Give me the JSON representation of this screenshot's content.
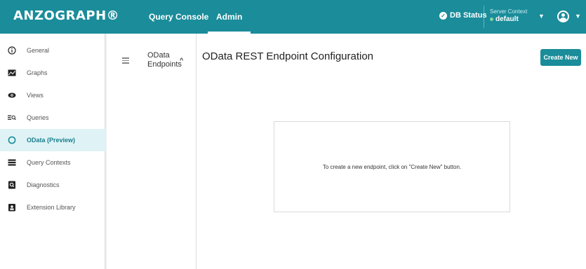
{
  "header": {
    "brand": "ANZOGRAPH®",
    "nav": [
      {
        "label": "Query Console"
      },
      {
        "label": "Admin"
      }
    ],
    "db_status": "DB Status",
    "server_context_label": "Server Context",
    "server_context_value": "default",
    "accent_color": "#1a8c9a"
  },
  "sidebar": {
    "items": [
      {
        "label": "General",
        "icon": "info-circle-icon"
      },
      {
        "label": "Graphs",
        "icon": "image-graph-icon"
      },
      {
        "label": "Views",
        "icon": "eye-icon"
      },
      {
        "label": "Queries",
        "icon": "queries-search-icon"
      },
      {
        "label": "OData (Preview)",
        "icon": "odata-circle-icon",
        "active": true
      },
      {
        "label": "Query Contexts",
        "icon": "list-icon"
      },
      {
        "label": "Diagnostics",
        "icon": "diagnostics-icon"
      },
      {
        "label": "Extension Library",
        "icon": "library-icon"
      }
    ]
  },
  "subnav": {
    "heading_line1": "OData",
    "heading_line2": "Endpoints"
  },
  "main": {
    "title": "OData REST Endpoint Configuration",
    "create_button": "Create New",
    "empty_message": "To create a new endpoint, click on \"Create New\" button."
  }
}
